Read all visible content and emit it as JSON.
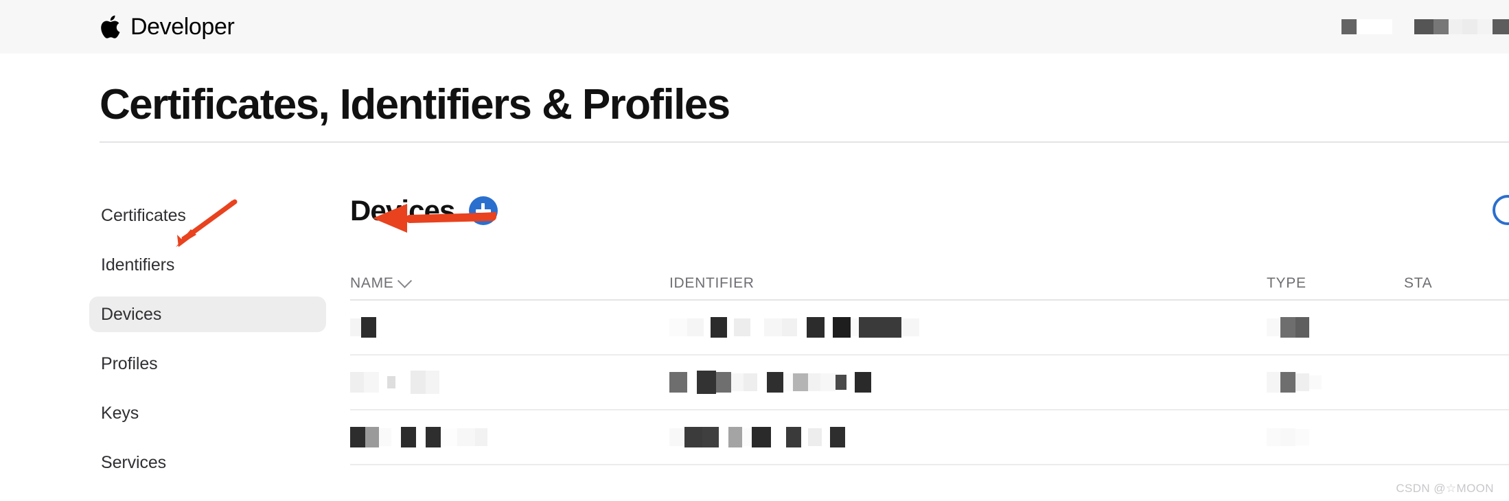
{
  "globalnav": {
    "logo_icon": "apple-logo-icon",
    "brand": "Developer",
    "right_items": [
      {
        "name": "account-redaction",
        "blocks": [
          [
            22,
            22,
            "#646464"
          ],
          [
            52,
            22,
            "#ffffff"
          ]
        ]
      },
      {
        "name": "menu-redaction",
        "blocks": [
          [
            28,
            22,
            "#555555"
          ],
          [
            22,
            22,
            "#777777"
          ],
          [
            20,
            22,
            "#f0f0f0"
          ],
          [
            22,
            22,
            "#ececec"
          ],
          [
            22,
            22,
            "#f3f3f3"
          ],
          [
            24,
            22,
            "#5d5d5d"
          ]
        ]
      }
    ]
  },
  "page": {
    "title": "Certificates, Identifiers & Profiles"
  },
  "sidebar": {
    "items": [
      {
        "label": "Certificates",
        "name": "sidebar-item-certificates",
        "selected": false
      },
      {
        "label": "Identifiers",
        "name": "sidebar-item-identifiers",
        "selected": false
      },
      {
        "label": "Devices",
        "name": "sidebar-item-devices",
        "selected": true
      },
      {
        "label": "Profiles",
        "name": "sidebar-item-profiles",
        "selected": false
      },
      {
        "label": "Keys",
        "name": "sidebar-item-keys",
        "selected": false
      },
      {
        "label": "Services",
        "name": "sidebar-item-services",
        "selected": false
      }
    ]
  },
  "panel": {
    "title": "Devices",
    "add_button_label": "+",
    "add_button_color": "#2b6fce",
    "action_icon": "circle-action-icon"
  },
  "table": {
    "columns": [
      {
        "label": "NAME",
        "key": "name",
        "sortable": true,
        "sort_icon": "chevron-down-icon"
      },
      {
        "label": "IDENTIFIER",
        "key": "identifier",
        "sortable": false
      },
      {
        "label": "TYPE",
        "key": "type",
        "sortable": false
      },
      {
        "label": "STATUS",
        "key": "status",
        "sortable": false,
        "truncated_label": "STA"
      }
    ],
    "rows": [
      {
        "name_blocks": [
          [
            16,
            26,
            "#f4f4f4"
          ],
          [
            22,
            30,
            "#2c2c2c"
          ]
        ],
        "ident_blocks": [
          [
            26,
            26,
            "#fbfbfb"
          ],
          [
            24,
            26,
            "#f5f5f5"
          ],
          [
            10,
            26,
            "#ffffff"
          ],
          [
            24,
            30,
            "#2b2b2b"
          ],
          [
            10,
            26,
            "#ffffff"
          ],
          [
            24,
            26,
            "#ededed"
          ],
          [
            20,
            26,
            "#ffffff"
          ],
          [
            26,
            26,
            "#f6f6f6"
          ],
          [
            22,
            26,
            "#f1f1f1"
          ],
          [
            14,
            26,
            "#ffffff"
          ],
          [
            26,
            30,
            "#2c2c2c"
          ],
          [
            12,
            26,
            "#ffffff"
          ],
          [
            26,
            30,
            "#1e1e1e"
          ],
          [
            12,
            26,
            "#fafafa"
          ],
          [
            62,
            30,
            "#3a3a3a"
          ],
          [
            26,
            26,
            "#f6f6f6"
          ]
        ],
        "type_blocks": [
          [
            20,
            26,
            "#f8f8f8"
          ],
          [
            22,
            30,
            "#6e6e6e"
          ],
          [
            20,
            30,
            "#5f5f5f"
          ]
        ],
        "status_blocks": []
      },
      {
        "name_blocks": [
          [
            20,
            30,
            "#efefef"
          ],
          [
            22,
            30,
            "#f6f6f6"
          ],
          [
            12,
            26,
            "#ffffff"
          ],
          [
            12,
            18,
            "#dedede"
          ],
          [
            22,
            26,
            "#ffffff"
          ],
          [
            22,
            34,
            "#ececec"
          ],
          [
            20,
            34,
            "#f4f4f4"
          ]
        ],
        "ident_blocks": [
          [
            26,
            30,
            "#6e6e6e"
          ],
          [
            14,
            26,
            "#ffffff"
          ],
          [
            28,
            34,
            "#333333"
          ],
          [
            22,
            30,
            "#6f6f6f"
          ],
          [
            18,
            26,
            "#f6f6f6"
          ],
          [
            20,
            26,
            "#eeeeee"
          ],
          [
            14,
            26,
            "#ffffff"
          ],
          [
            24,
            30,
            "#2f2f2f"
          ],
          [
            14,
            26,
            "#fbfbfb"
          ],
          [
            22,
            26,
            "#b4b4b4"
          ],
          [
            18,
            26,
            "#f2f2f2"
          ],
          [
            22,
            26,
            "#f7f7f7"
          ],
          [
            16,
            22,
            "#4a4a4a"
          ],
          [
            12,
            22,
            "#ffffff"
          ],
          [
            24,
            30,
            "#2a2a2a"
          ]
        ],
        "type_blocks": [
          [
            20,
            30,
            "#f5f5f5"
          ],
          [
            22,
            30,
            "#6e6e6e"
          ],
          [
            20,
            26,
            "#efefef"
          ],
          [
            18,
            20,
            "#fafafa"
          ]
        ],
        "status_blocks": []
      },
      {
        "name_blocks": [
          [
            22,
            30,
            "#2d2d2d"
          ],
          [
            20,
            30,
            "#9a9a9a"
          ],
          [
            18,
            26,
            "#fafafa"
          ],
          [
            14,
            26,
            "#ffffff"
          ],
          [
            22,
            30,
            "#2c2c2c"
          ],
          [
            14,
            26,
            "#ffffff"
          ],
          [
            22,
            30,
            "#2e2e2e"
          ],
          [
            24,
            26,
            "#fdfdfd"
          ],
          [
            26,
            26,
            "#f7f7f7"
          ],
          [
            18,
            26,
            "#f2f2f2"
          ]
        ],
        "ident_blocks": [
          [
            22,
            26,
            "#f8f8f8"
          ],
          [
            26,
            30,
            "#3b3b3b"
          ],
          [
            24,
            30,
            "#3f3f3f"
          ],
          [
            14,
            26,
            "#ffffff"
          ],
          [
            20,
            30,
            "#a4a4a4"
          ],
          [
            14,
            26,
            "#fbfbfb"
          ],
          [
            28,
            30,
            "#2a2a2a"
          ],
          [
            22,
            26,
            "#ffffff"
          ],
          [
            22,
            30,
            "#3a3a3a"
          ],
          [
            10,
            26,
            "#ffffff"
          ],
          [
            20,
            26,
            "#ededed"
          ],
          [
            12,
            26,
            "#ffffff"
          ],
          [
            22,
            30,
            "#2e2e2e"
          ]
        ],
        "type_blocks": [
          [
            20,
            26,
            "#fafafa"
          ],
          [
            22,
            26,
            "#f8f8f8"
          ],
          [
            20,
            24,
            "#fbfbfb"
          ]
        ],
        "status_blocks": []
      }
    ]
  },
  "annotations": {
    "arrow_color": "#e8421e",
    "arrows": [
      {
        "name": "arrow-pointing-to-devices-nav",
        "target": "sidebar-item-devices"
      },
      {
        "name": "arrow-pointing-to-add-device-button",
        "target": "add-device-button"
      }
    ]
  },
  "watermark": {
    "text": "CSDN @☆MOON"
  }
}
